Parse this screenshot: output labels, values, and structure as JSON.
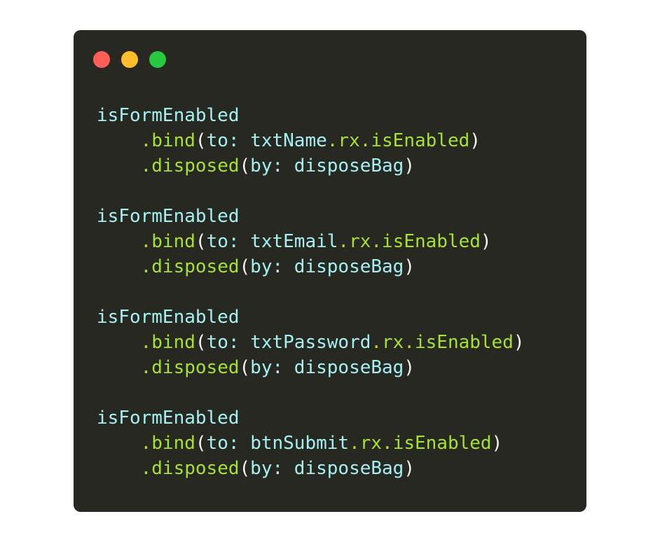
{
  "colors": {
    "window_bg": "#272822",
    "page_bg": "#ffffff",
    "close": "#ff5f56",
    "minimize": "#ffbd2e",
    "maximize": "#27c93f",
    "identifier": "#a6f0f2",
    "method": "#a6e22e",
    "punctuation": "#f8f8f2"
  },
  "window_controls": [
    {
      "name": "close-button",
      "icon": "red-circle"
    },
    {
      "name": "minimize-button",
      "icon": "yellow-circle"
    },
    {
      "name": "maximize-button",
      "icon": "green-circle"
    }
  ],
  "blocks": [
    {
      "subject": "isFormEnabled",
      "bind": {
        "method": ".bind",
        "open": "(",
        "label": "to:",
        "target": "txtName",
        "prop": ".rx.isEnabled",
        "close": ")"
      },
      "disposed": {
        "method": ".disposed",
        "open": "(",
        "label": "by:",
        "bag": "disposeBag",
        "close": ")"
      }
    },
    {
      "subject": "isFormEnabled",
      "bind": {
        "method": ".bind",
        "open": "(",
        "label": "to:",
        "target": "txtEmail",
        "prop": ".rx.isEnabled",
        "close": ")"
      },
      "disposed": {
        "method": ".disposed",
        "open": "(",
        "label": "by:",
        "bag": "disposeBag",
        "close": ")"
      }
    },
    {
      "subject": "isFormEnabled",
      "bind": {
        "method": ".bind",
        "open": "(",
        "label": "to:",
        "target": "txtPassword",
        "prop": ".rx.isEnabled",
        "close": ")"
      },
      "disposed": {
        "method": ".disposed",
        "open": "(",
        "label": "by:",
        "bag": "disposeBag",
        "close": ")"
      }
    },
    {
      "subject": "isFormEnabled",
      "bind": {
        "method": ".bind",
        "open": "(",
        "label": "to:",
        "target": "btnSubmit",
        "prop": ".rx.isEnabled",
        "close": ")"
      },
      "disposed": {
        "method": ".disposed",
        "open": "(",
        "label": "by:",
        "bag": "disposeBag",
        "close": ")"
      }
    }
  ]
}
